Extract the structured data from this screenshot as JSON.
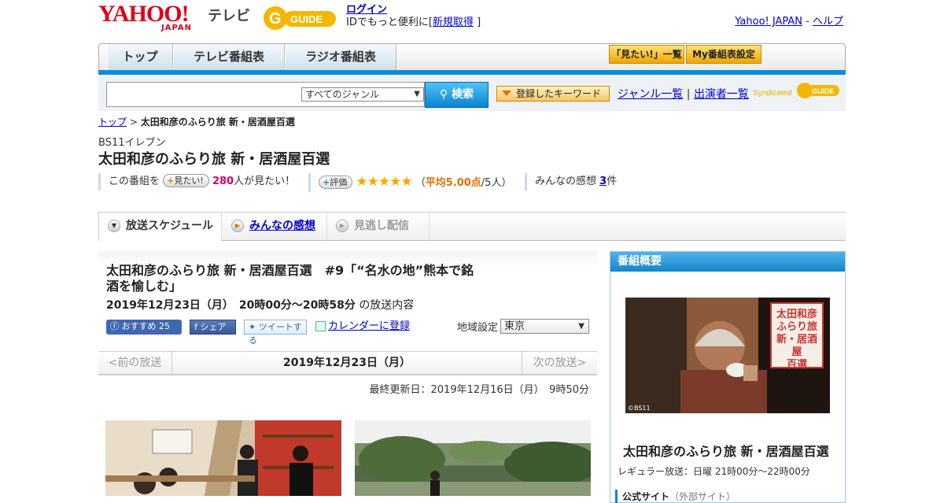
{
  "header": {
    "yahoo_logo": "YAHOO!",
    "japan": "JAPAN",
    "tv": "テレビ",
    "guide_logo": "GUIDE",
    "login": "ログイン",
    "login_sub_pre": "IDでもっと便利に[",
    "signup": "新規取得",
    "login_sub_post": "]",
    "yahoo_japan_link": "Yahoo! JAPAN",
    "separator": " - ",
    "help_link": "ヘルプ"
  },
  "nav": {
    "tabs": [
      "トップ",
      "テレビ番組表",
      "ラジオ番組表"
    ],
    "mitai_list": "「見たい!」一覧",
    "my_schedule": "My番組表設定"
  },
  "search": {
    "genre_select": "すべてのジャンル",
    "button": "検索",
    "keyword_button": "登録したキーワード",
    "genre_list": "ジャンル一覧",
    "divider": "|",
    "performer_list": "出演者一覧",
    "syndicated": "Syndicated"
  },
  "breadcrumb": {
    "top": "トップ",
    "sep": " > ",
    "current": "太田和彦のふらり旅 新・居酒屋百選"
  },
  "program": {
    "channel": "BS11イレブン",
    "title": "太田和彦のふらり旅 新・居酒屋百選",
    "want_pre": "この番組を",
    "want_badge": "見たい!",
    "want_count": "280",
    "want_post": "人が見たい！",
    "rating_badge": "評価",
    "stars": "★★★★★",
    "avg_open": "（",
    "avg": "平均5.00点",
    "avg_close": "/5人）",
    "reviews_pre": "みんなの感想 ",
    "reviews_count": "3",
    "reviews_post": "件"
  },
  "subtabs": [
    "放送スケジュール",
    "みんなの感想",
    "見逃し配信"
  ],
  "episode": {
    "title": "太田和彦のふらり旅 新・居酒屋百選　#9「“名水の地”熊本で銘酒を愉しむ」",
    "datetime": "2019年12月23日（月）　20時00分～20時58分",
    "datetime_suffix": "の放送内容",
    "fb_recommend": "おすすめ",
    "fb_count": "25",
    "fb_share": "シェア",
    "tweet": "ツイートする",
    "calendar": "カレンダーに登録",
    "region_label": "地域設定",
    "region_value": "東京"
  },
  "pager": {
    "prev": "<前の放送",
    "date": "2019年12月23日（月）",
    "next": "次の放送>"
  },
  "updated": "最終更新日：2019年12月16日（月）　9時50分",
  "sidebar": {
    "heading": "番組概要",
    "stamp_text": "太田和彦ふらり旅新・居酒屋百選",
    "copyright": "©BS11",
    "title": "太田和彦のふらり旅 新・居酒屋百選",
    "regular": "レギュラー放送：日曜 21時00分～22時00分",
    "official": "公式サイト",
    "external": "（外部サイト）"
  }
}
